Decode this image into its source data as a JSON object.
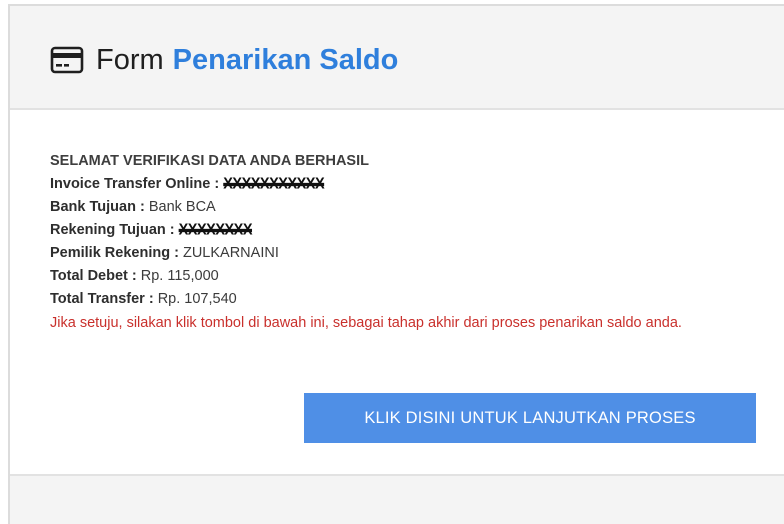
{
  "header": {
    "icon": "credit-card-icon",
    "title_prefix": "Form",
    "title_accent": "Penarikan Saldo",
    "accent_color": "#2f7fdc"
  },
  "details": {
    "headline": "SELAMAT VERIFIKASI DATA ANDA BERHASIL",
    "invoice_label": "Invoice Transfer Online :",
    "invoice_value": "XXXXXXXXXXX",
    "bank_label": "Bank Tujuan :",
    "bank_value": "Bank BCA",
    "account_label": "Rekening Tujuan :",
    "account_value": "XXXXXXXX",
    "owner_label": "Pemilik Rekening :",
    "owner_value": "ZULKARNAINI",
    "debit_label": "Total Debet :",
    "debit_value": "Rp. 115,000",
    "transfer_label": "Total Transfer :",
    "transfer_value": "Rp. 107,540",
    "notice": "Jika setuju, silakan klik tombol di bawah ini, sebagai tahap akhir dari proses penarikan saldo anda.",
    "notice_color": "#c9302c"
  },
  "action": {
    "button_label": "KLIK DISINI UNTUK LANJUTKAN PROSES",
    "button_color": "#4f8fe6"
  }
}
